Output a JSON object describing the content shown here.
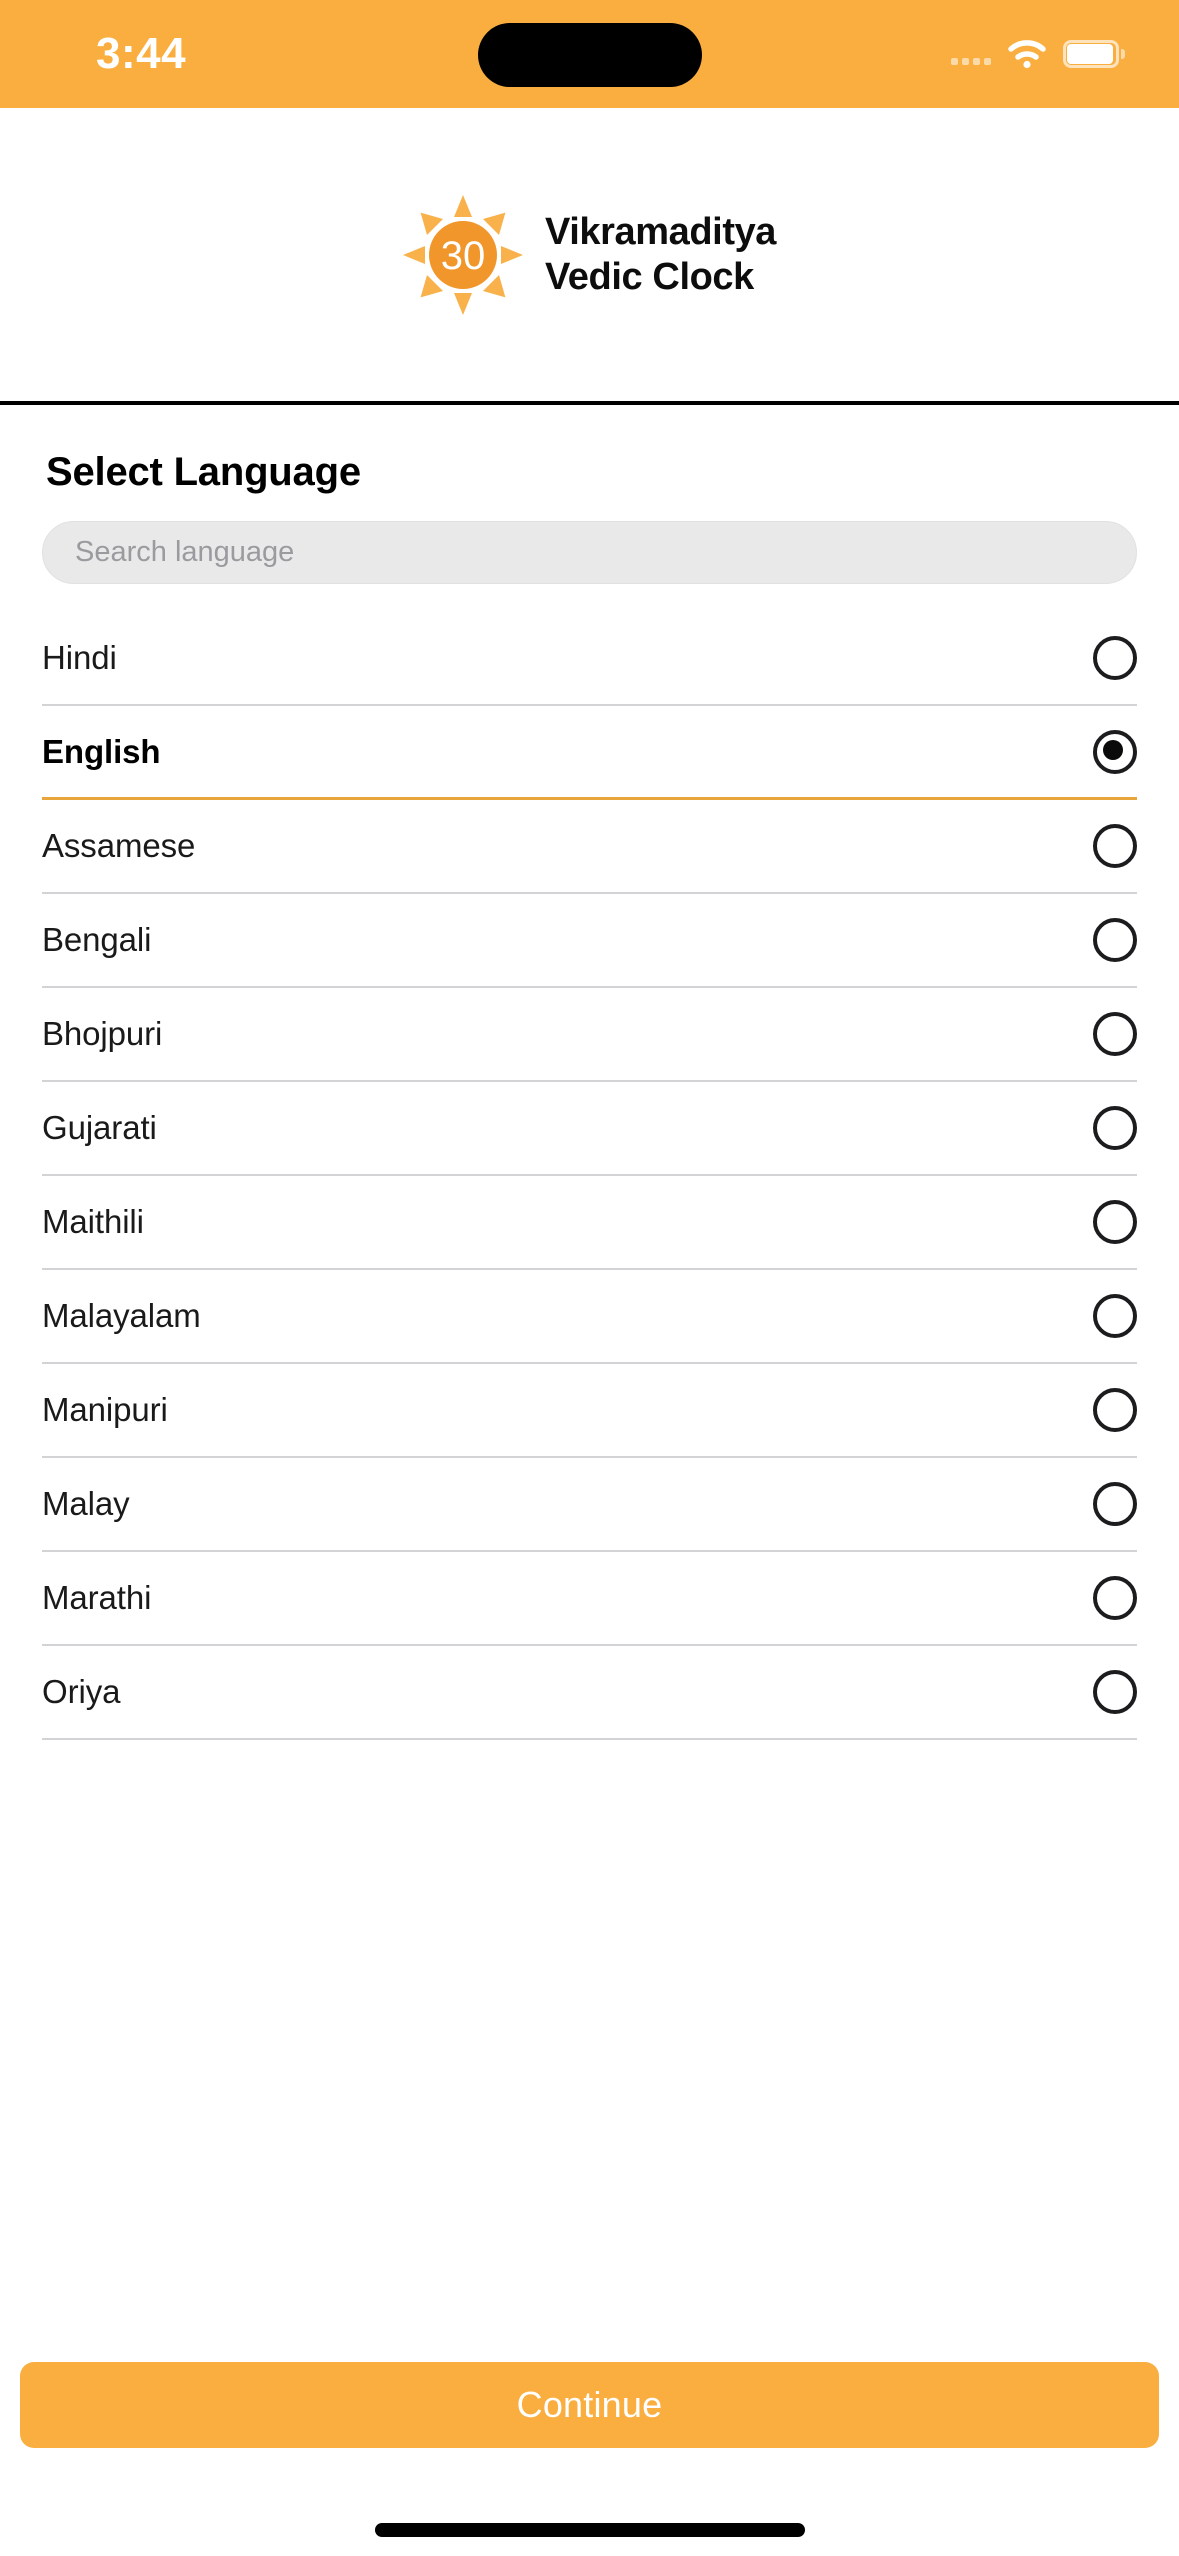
{
  "status_bar": {
    "time": "3:44",
    "signal_icon": "signal-dots-icon",
    "wifi_icon": "wifi-icon",
    "battery_icon": "battery-icon",
    "background_color": "#F9AE3F"
  },
  "app_header": {
    "logo_icon": "sun-30-logo-icon",
    "logo_number": "30",
    "brand_line1": "Vikramaditya",
    "brand_line2": "Vedic Clock",
    "logo_color": "#F0962A",
    "ray_color": "#F9B24B"
  },
  "main": {
    "title": "Select Language",
    "search": {
      "placeholder": "Search language",
      "value": ""
    },
    "languages": [
      {
        "label": "Hindi",
        "selected": false
      },
      {
        "label": "English",
        "selected": true
      },
      {
        "label": "Assamese",
        "selected": false
      },
      {
        "label": "Bengali",
        "selected": false
      },
      {
        "label": "Bhojpuri",
        "selected": false
      },
      {
        "label": "Gujarati",
        "selected": false
      },
      {
        "label": "Maithili",
        "selected": false
      },
      {
        "label": "Malayalam",
        "selected": false
      },
      {
        "label": "Manipuri",
        "selected": false
      },
      {
        "label": "Malay",
        "selected": false
      },
      {
        "label": "Marathi",
        "selected": false
      },
      {
        "label": "Oriya",
        "selected": false
      }
    ]
  },
  "footer": {
    "continue_label": "Continue",
    "accent_color": "#F9AE3F"
  }
}
